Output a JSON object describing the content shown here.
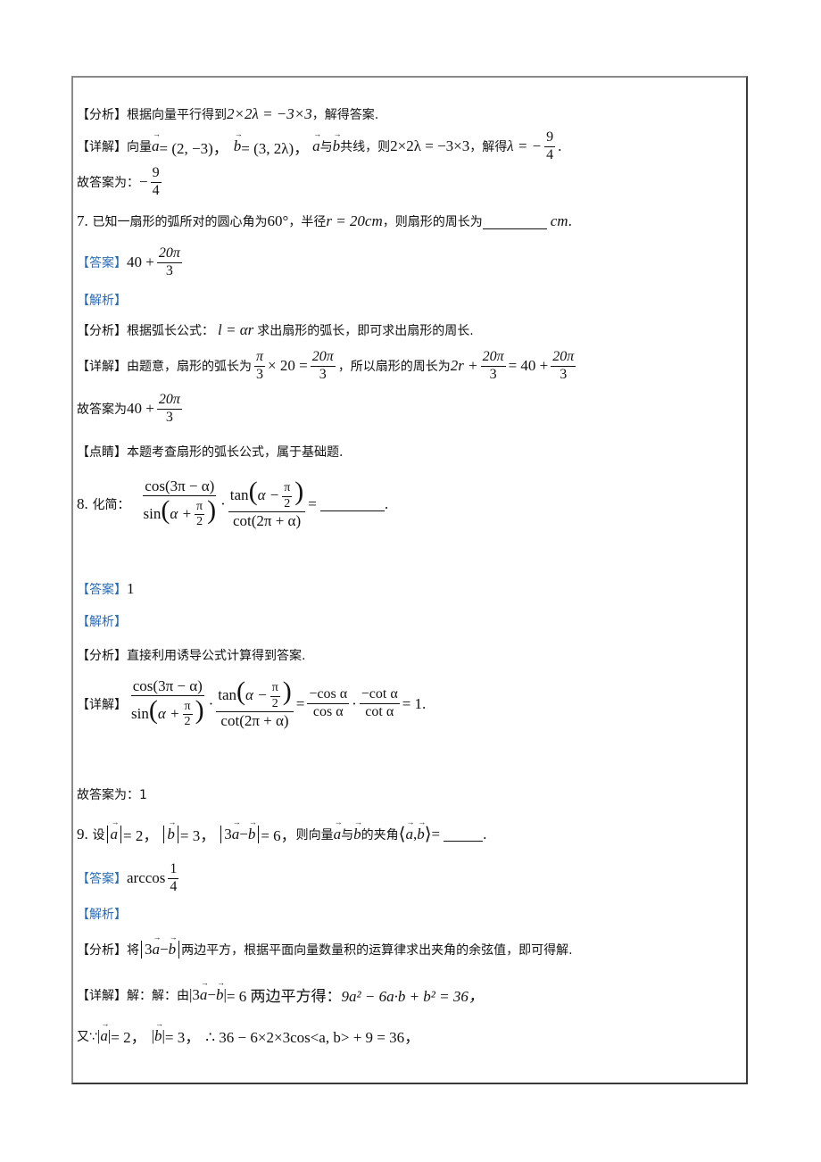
{
  "q6_tail": {
    "analysis_tag": "【分析】",
    "analysis_text": "根据向量平行得到",
    "analysis_eq": "2×2λ = −3×3",
    "analysis_end": "，解得答案.",
    "detail_tag": "【详解】",
    "detail_prefix": "向量",
    "a_eq": "= (2, −3)，",
    "b_eq": "= (3, 2λ)，",
    "collinear_text": "与",
    "collinear_end": "共线，则",
    "detail_eq": "2×2λ = −3×3",
    "solve_text": "，解得",
    "lambda_lhs": "λ = −",
    "lambda_num": "9",
    "lambda_den": "4",
    "answer_prefix": "故答案为：",
    "answer_sign": "−",
    "answer_num": "9",
    "answer_den": "4"
  },
  "q7": {
    "number": "7.",
    "stem_a": "已知一扇形的弧所对的圆心角为",
    "angle": "60°",
    "stem_b": "，半径",
    "radius": "r = 20cm",
    "stem_c": "，则扇形的周长为",
    "unit": "cm",
    "period": ".",
    "answer_tag": "【答案】",
    "answer_int": "40 +",
    "answer_num": "20π",
    "answer_den": "3",
    "jiexi_tag": "【解析】",
    "analysis_tag": "【分析】",
    "analysis_a": "根据弧长公式：",
    "analysis_formula": "l = αr",
    "analysis_b": "求出扇形的弧长，即可求出扇形的周长.",
    "detail_tag": "【详解】",
    "detail_a": "由题意，扇形的弧长为",
    "d_f1_num": "π",
    "d_f1_den": "3",
    "d_times": "× 20 =",
    "d_f2_num": "20π",
    "d_f2_den": "3",
    "detail_b": "，所以扇形的周长为",
    "d_2r": "2r +",
    "d_f3_num": "20π",
    "d_f3_den": "3",
    "d_eq": "= 40 +",
    "d_f4_num": "20π",
    "d_f4_den": "3",
    "final_prefix": "故答案为",
    "final_int": "40 +",
    "final_num": "20π",
    "final_den": "3",
    "comment_tag": "【点睛】",
    "comment_text": "本题考查扇形的弧长公式，属于基础题."
  },
  "q8": {
    "number": "8.",
    "stem": "化简：",
    "f1_num": "cos(3π − α)",
    "f1_den_fn": "sin",
    "f1_den_in": "α +",
    "pi": "π",
    "two": "2",
    "dot": "·",
    "f2_num_fn": "tan",
    "f2_num_in": "α −",
    "f2_den": "cot(2π + α)",
    "eq": "=",
    "period": ".",
    "answer_tag": "【答案】",
    "answer": "1",
    "jiexi_tag": "【解析】",
    "analysis_tag": "【分析】",
    "analysis_text": "直接利用诱导公式计算得到答案.",
    "detail_tag": "【详解】",
    "r1_num": "−cos α",
    "r1_den": "cos α",
    "r2_num": "−cot α",
    "r2_den": "cot α",
    "result": "= 1.",
    "final": "故答案为：1"
  },
  "q9": {
    "number": "9.",
    "stem_a": "设",
    "a_mag": "= 2，",
    "b_mag": "= 3，",
    "diff_three": "3",
    "minus": "−",
    "diff_mag": "= 6，",
    "stem_b": "则向量",
    "with": "与",
    "stem_c": "的夹角",
    "angle_eq": "=",
    "period": ".",
    "answer_tag": "【答案】",
    "answer_fn": "arccos",
    "answer_num": "1",
    "answer_den": "4",
    "jiexi_tag": "【解析】",
    "analysis_tag": "【分析】",
    "analysis_a": "将",
    "analysis_b": "两边平方，根据平面向量数量积的运算律求出夹角的余弦值，即可得解.",
    "detail_tag": "【详解】",
    "detail_a": "解：解：由",
    "detail_b": "= 6 两边平方得：",
    "detail_eq": "9a² − 6a·b + b² = 36，",
    "line3_a": "又∵",
    "line3_amag": "= 2，",
    "line3_bmag": "= 3，",
    "line3_eq": "∴ 36 − 6×2×3cos<a, b> + 9 = 36，"
  },
  "vector_labels": {
    "a": "a",
    "b": "b"
  }
}
